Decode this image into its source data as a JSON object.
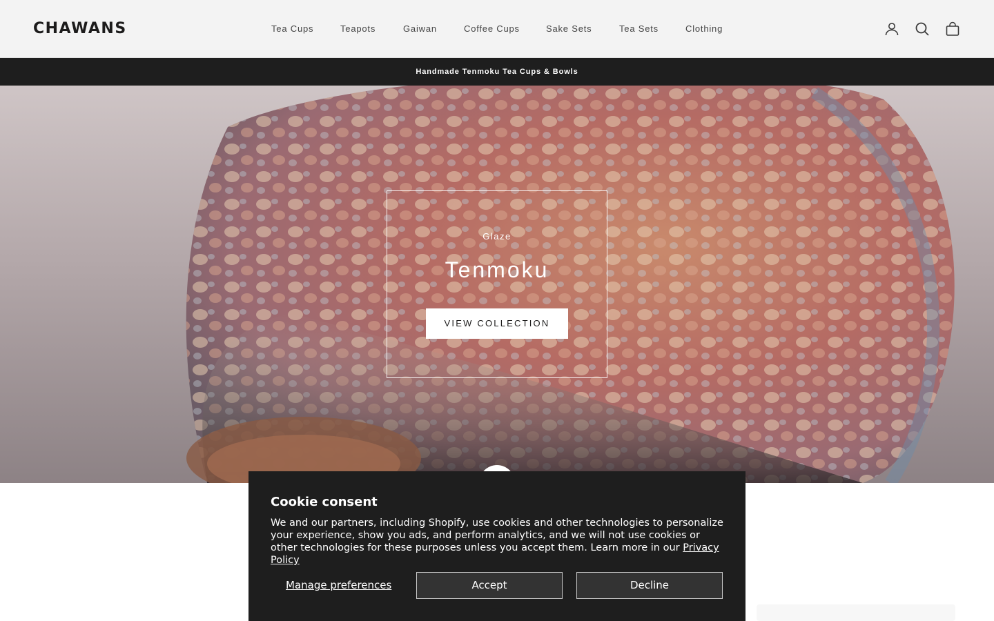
{
  "brand": {
    "logo": "CHAWANS"
  },
  "nav": {
    "items": [
      "Tea Cups",
      "Teapots",
      "Gaiwan",
      "Coffee Cups",
      "Sake Sets",
      "Tea Sets",
      "Clothing"
    ]
  },
  "header_icons": [
    "account-icon",
    "search-icon",
    "cart-icon"
  ],
  "announcement": {
    "text": "Handmade Tenmoku Tea Cups & Bowls"
  },
  "hero": {
    "eyebrow": "Glaze",
    "title": "Tenmoku",
    "button_label": "VIEW COLLECTION"
  },
  "cookie": {
    "title": "Cookie consent",
    "body": "We and our partners, including Shopify, use cookies and other technologies to personalize your experience, show you ads, and perform analytics, and we will not use cookies or other technologies for these purposes unless you accept them. Learn more in our",
    "policy_link": "Privacy Policy",
    "manage_label": "Manage preferences",
    "accept_label": "Accept",
    "decline_label": "Decline"
  },
  "colors": {
    "header_bg": "#f3f3f3",
    "announcement_bg": "#1e1e1e",
    "cookie_bg": "#1e1e1e",
    "button_bg": "#333333"
  }
}
